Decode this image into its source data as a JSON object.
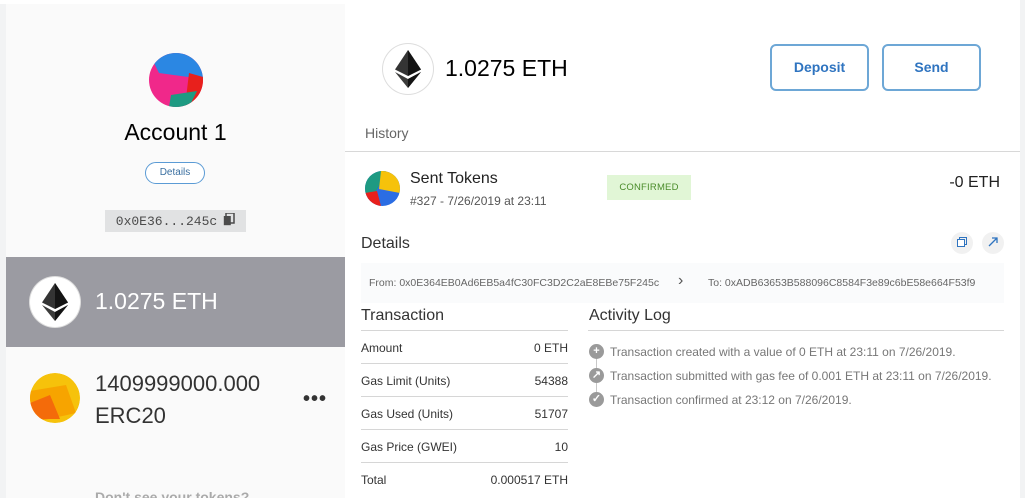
{
  "account": {
    "name": "Account 1",
    "details_label": "Details",
    "address_short": "0x0E36...245c"
  },
  "tokens": [
    {
      "balance": "1.0275 ETH",
      "icon": "ethereum-icon",
      "selected": true
    },
    {
      "amount": "1409999000.000",
      "unit": "ERC20",
      "icon": "token-identicon",
      "selected": false
    }
  ],
  "sidebar": {
    "menu_icon": "more-horizontal-icon",
    "dont_see_text": "Don't see your tokens?"
  },
  "main": {
    "balance": "1.0275 ETH",
    "deposit_label": "Deposit",
    "send_label": "Send",
    "history_label": "History"
  },
  "transaction": {
    "title": "Sent Tokens",
    "subtitle": "#327 - 7/26/2019 at 23:11",
    "status": "CONFIRMED",
    "amount": "-0 ETH",
    "details_label": "Details",
    "from": "From: 0x0E364EB0Ad6EB5a4fC30FC3D2C2aE8EBe75F245c",
    "to": "To: 0xADB63653B588096C8584F3e89c6bE58e664F53f9",
    "section_title": "Transaction",
    "rows": [
      {
        "label": "Amount",
        "value": "0 ETH"
      },
      {
        "label": "Gas Limit (Units)",
        "value": "54388"
      },
      {
        "label": "Gas Used (Units)",
        "value": "51707"
      },
      {
        "label": "Gas Price (GWEI)",
        "value": "10"
      },
      {
        "label": "Total",
        "value": "0.000517 ETH"
      }
    ]
  },
  "activity": {
    "title": "Activity Log",
    "entries": [
      {
        "icon": "plus-circle-icon",
        "text": "Transaction created with a value of 0 ETH at 23:11 on 7/26/2019."
      },
      {
        "icon": "arrow-up-circle-icon",
        "text": "Transaction submitted with gas fee of 0.001 ETH at 23:11 on 7/26/2019."
      },
      {
        "icon": "check-circle-icon",
        "text": "Transaction confirmed at 23:12 on 7/26/2019."
      }
    ]
  },
  "colors": {
    "accent": "#2f74c0",
    "selected_row": "#9b9ba2",
    "confirmed_bg": "#e1f6d6",
    "confirmed_text": "#4a8c2a"
  }
}
